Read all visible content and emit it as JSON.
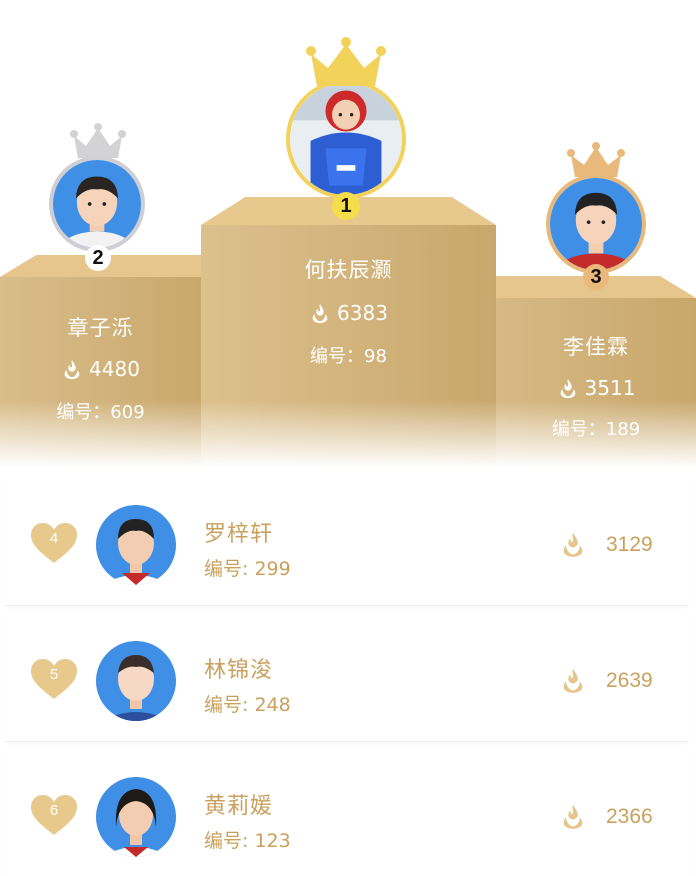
{
  "colors": {
    "gold": "#c9a15e",
    "podium_light": "#e8c98d",
    "podium_dark": "#c8a76b",
    "crown_gold": "#f2d25a",
    "crown_silver": "#d3d3d6",
    "crown_bronze": "#e9b97c",
    "heart": "#e8c98d"
  },
  "icons": {
    "score": "flame-icon",
    "rank": "heart-icon",
    "crown": "crown-icon"
  },
  "podium": {
    "first": {
      "rank": "1",
      "name": "何扶辰灏",
      "score": "6383",
      "id": "编号：98"
    },
    "second": {
      "rank": "2",
      "name": "章子泺",
      "score": "4480",
      "id": "编号：609"
    },
    "third": {
      "rank": "3",
      "name": "李佳霖",
      "score": "3511",
      "id": "编号：189"
    }
  },
  "list": [
    {
      "rank": "4",
      "name": "罗梓轩",
      "id": "编号: 299",
      "score": "3129"
    },
    {
      "rank": "5",
      "name": "林锦浚",
      "id": "编号: 248",
      "score": "2639"
    },
    {
      "rank": "6",
      "name": "黄莉媛",
      "id": "编号: 123",
      "score": "2366"
    }
  ]
}
